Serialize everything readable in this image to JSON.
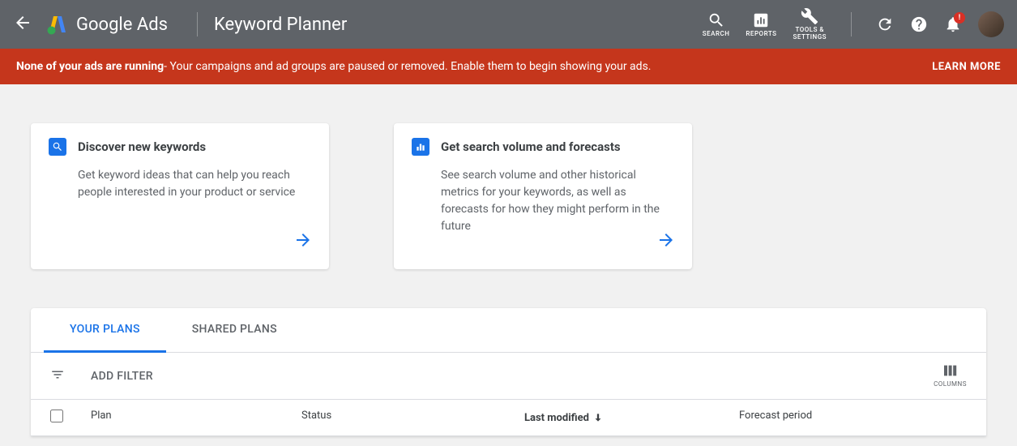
{
  "header": {
    "product": "Google Ads",
    "page_title": "Keyword Planner",
    "tools": {
      "search": "SEARCH",
      "reports": "REPORTS",
      "settings": "TOOLS &\nSETTINGS"
    },
    "notif_badge": "!"
  },
  "alert": {
    "bold": "None of your ads are running",
    "text": " - Your campaigns and ad groups are paused or removed. Enable them to begin showing your ads.",
    "cta": "LEARN MORE"
  },
  "cards": {
    "discover": {
      "title": "Discover new keywords",
      "desc": "Get keyword ideas that can help you reach people interested in your product or service"
    },
    "forecast": {
      "title": "Get search volume and forecasts",
      "desc": "See search volume and other historical metrics for your keywords, as well as forecasts for how they might perform in the future"
    }
  },
  "plans": {
    "tabs": {
      "your": "YOUR PLANS",
      "shared": "SHARED PLANS"
    },
    "add_filter": "ADD FILTER",
    "columns_label": "COLUMNS",
    "headers": {
      "plan": "Plan",
      "status": "Status",
      "modified": "Last modified",
      "forecast": "Forecast period"
    }
  }
}
